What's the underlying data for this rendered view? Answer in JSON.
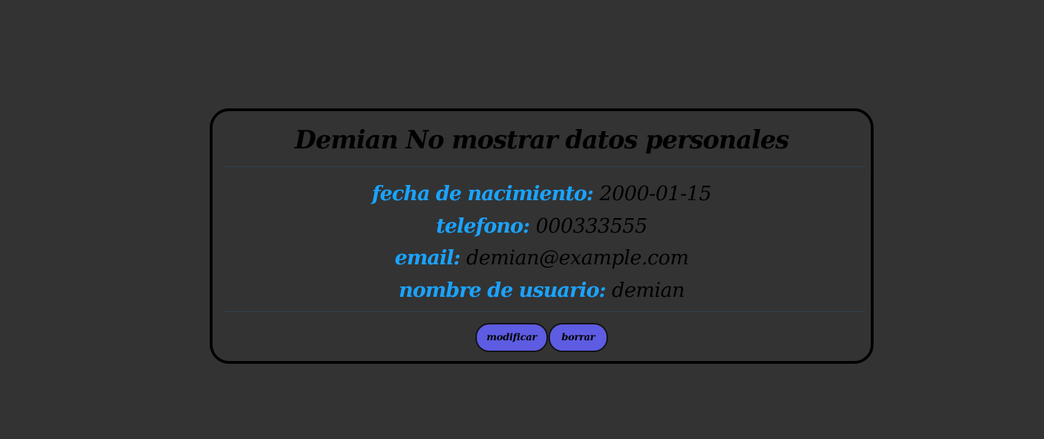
{
  "card": {
    "title": "Demian No mostrar datos personales",
    "fields": [
      {
        "label": "fecha de nacimiento:",
        "value": "2000-01-15"
      },
      {
        "label": "telefono:",
        "value": "000333555"
      },
      {
        "label": "email:",
        "value": "demian@example.com"
      },
      {
        "label": "nombre de usuario:",
        "value": "demian"
      }
    ],
    "actions": {
      "modify_label": "modificar",
      "delete_label": "borrar"
    }
  },
  "colors": {
    "background": "#333333",
    "card_border": "#000000",
    "label": "#1aa3ff",
    "value": "#000000",
    "button": "#5d5ce2",
    "divider": "#2d4452"
  }
}
